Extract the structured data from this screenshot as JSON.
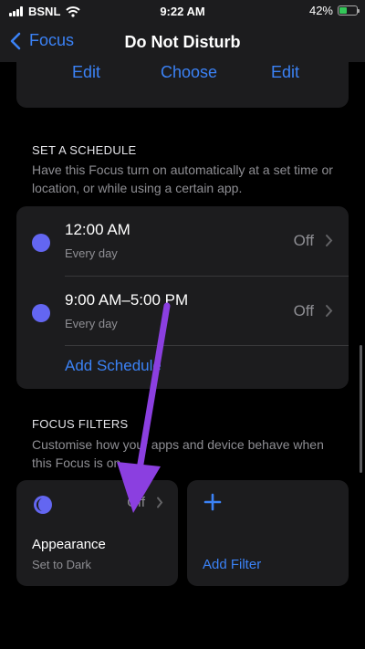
{
  "status": {
    "carrier": "BSNL",
    "time": "9:22 AM",
    "battery": "42%",
    "battery_level": 0.42
  },
  "nav": {
    "back_label": "Focus",
    "title": "Do Not Disturb"
  },
  "top_actions": [
    "Edit",
    "Choose",
    "Edit"
  ],
  "schedule": {
    "heading": "SET A SCHEDULE",
    "description": "Have this Focus turn on automatically at a set time or location, or while using a certain app.",
    "items": [
      {
        "time": "12:00 AM",
        "repeat": "Every day",
        "state": "Off"
      },
      {
        "time": "9:00 AM–5:00 PM",
        "repeat": "Every day",
        "state": "Off"
      }
    ],
    "add_label": "Add Schedule"
  },
  "filters": {
    "heading": "FOCUS FILTERS",
    "description": "Customise how your apps and device behave when this Focus is on.",
    "appearance": {
      "title": "Appearance",
      "subtitle": "Set to Dark",
      "state": "Off"
    },
    "add_label": "Add Filter"
  },
  "colors": {
    "accent": "#3b82f6",
    "clock_icon": "#6366f1",
    "annotation_arrow": "#8b3fe0"
  }
}
